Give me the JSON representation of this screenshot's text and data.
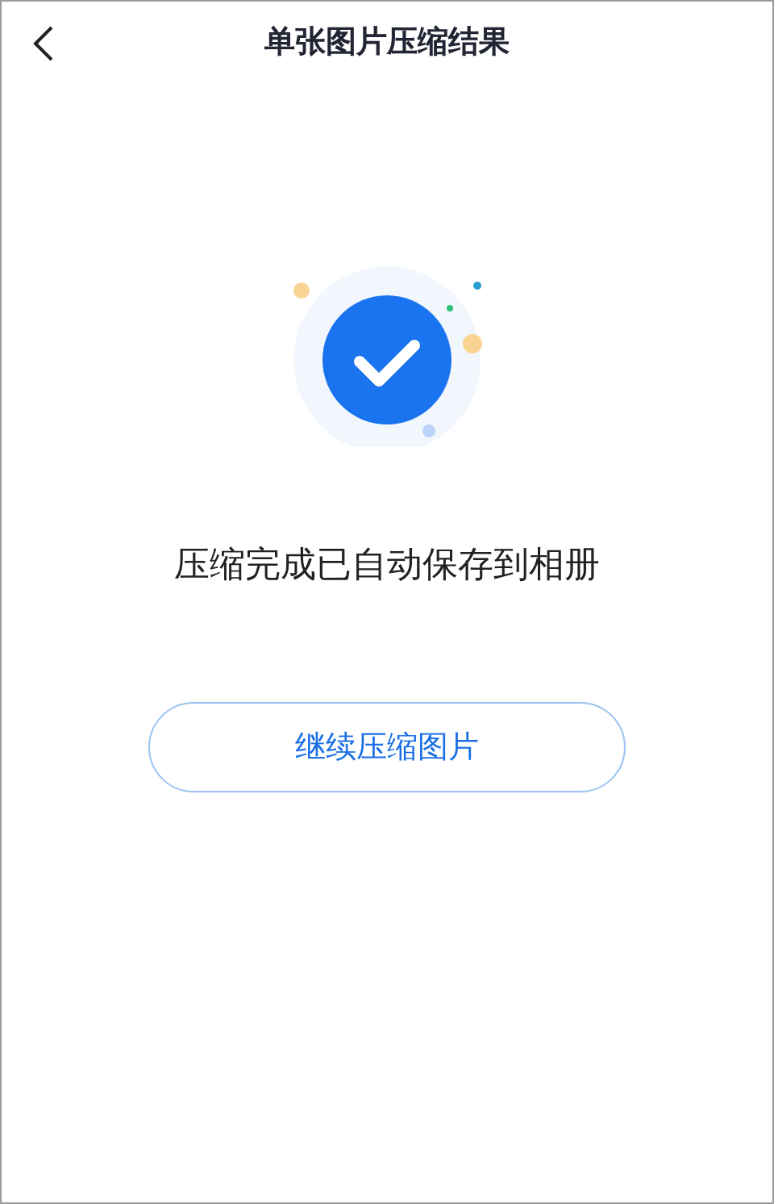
{
  "header": {
    "title": "单张图片压缩结果"
  },
  "result": {
    "message": "压缩完成已自动保存到相册"
  },
  "buttons": [
    "继续压缩图片"
  ]
}
